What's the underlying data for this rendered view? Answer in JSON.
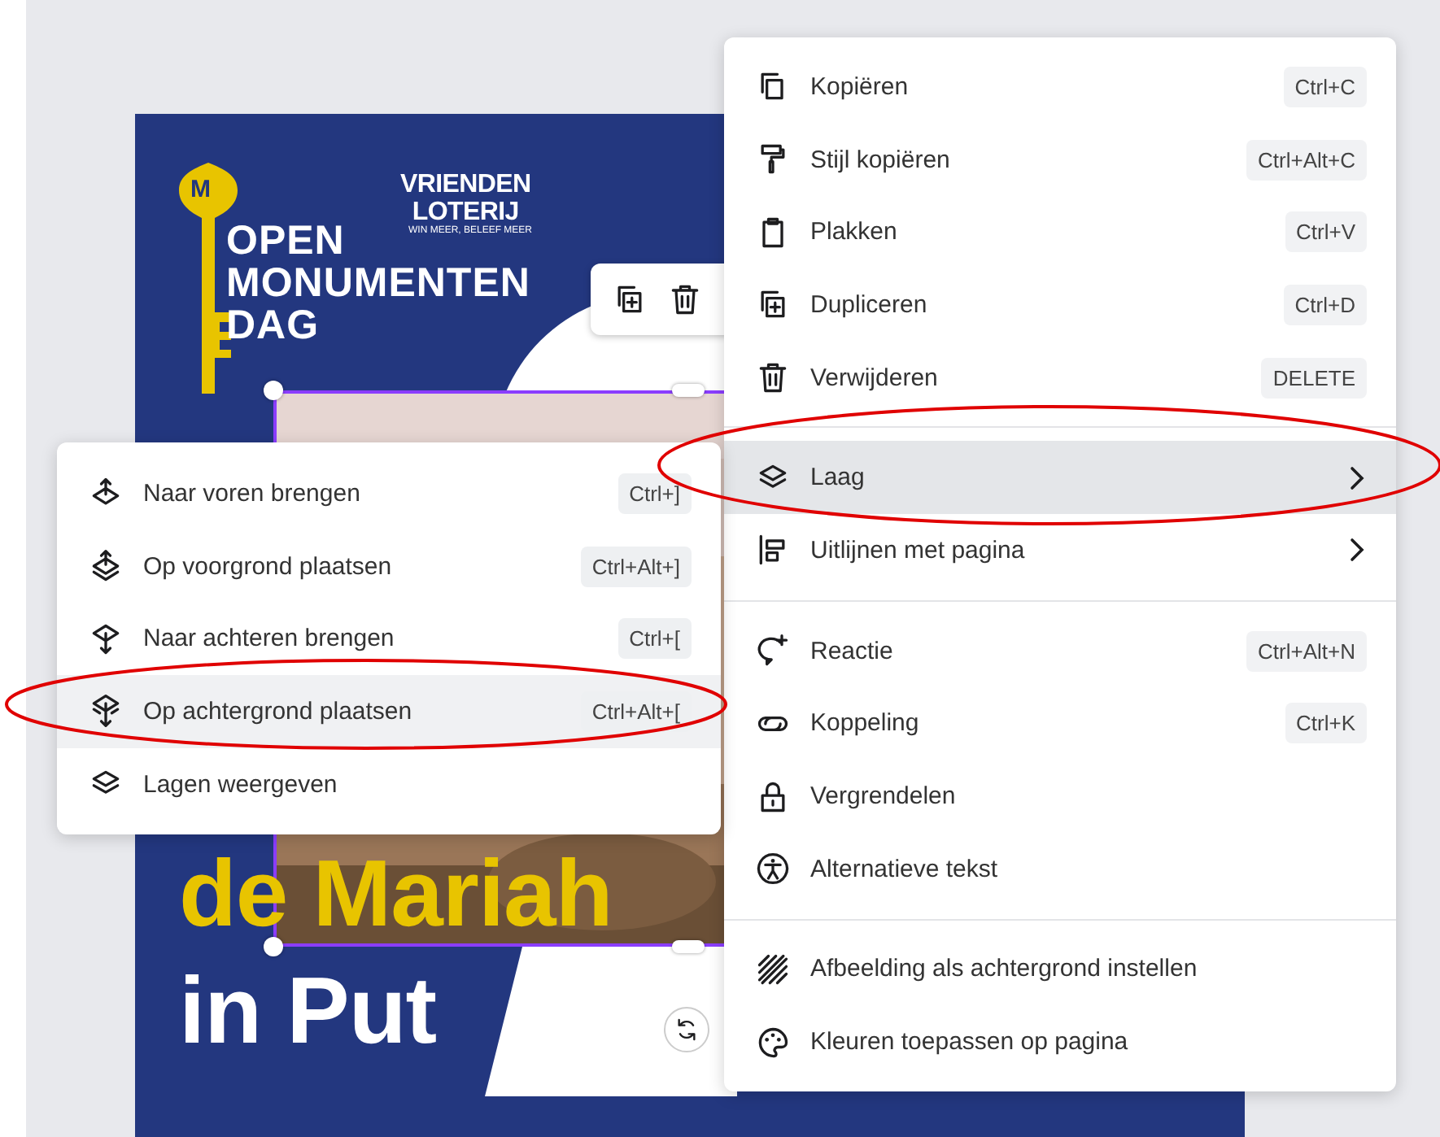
{
  "poster": {
    "key_letter": "M",
    "logo_lines": [
      "VRIENDEN",
      "LOTERIJ"
    ],
    "tagline": "WIN MEER, BELEEF MEER",
    "title_lines": [
      "OPEN",
      "MONUMENTEN",
      "DAG"
    ],
    "headline_lines": [
      "de Mariah",
      "in Put"
    ]
  },
  "context_menu": {
    "sections": [
      {
        "items": [
          {
            "label": "Kopiëren",
            "shortcut": "Ctrl+C",
            "submenu": false,
            "selected": false
          },
          {
            "label": "Stijl kopiëren",
            "shortcut": "Ctrl+Alt+C",
            "submenu": false,
            "selected": false
          },
          {
            "label": "Plakken",
            "shortcut": "Ctrl+V",
            "submenu": false,
            "selected": false
          },
          {
            "label": "Dupliceren",
            "shortcut": "Ctrl+D",
            "submenu": false,
            "selected": false
          },
          {
            "label": "Verwijderen",
            "shortcut": "DELETE",
            "submenu": false,
            "selected": false
          }
        ]
      },
      {
        "items": [
          {
            "label": "Laag",
            "submenu": true,
            "selected": true
          },
          {
            "label": "Uitlijnen met pagina",
            "submenu": true,
            "selected": false
          }
        ]
      },
      {
        "items": [
          {
            "label": "Reactie",
            "shortcut": "Ctrl+Alt+N",
            "submenu": false,
            "selected": false
          },
          {
            "label": "Koppeling",
            "shortcut": "Ctrl+K",
            "submenu": false,
            "selected": false
          },
          {
            "label": "Vergrendelen",
            "submenu": false,
            "selected": false
          },
          {
            "label": "Alternatieve tekst",
            "submenu": false,
            "selected": false
          }
        ]
      },
      {
        "items": [
          {
            "label": "Afbeelding als achtergrond instellen",
            "submenu": false,
            "selected": false
          },
          {
            "label": "Kleuren toepassen op pagina",
            "submenu": false,
            "selected": false
          }
        ]
      }
    ]
  },
  "layer_submenu": {
    "items": [
      {
        "label": "Naar voren brengen",
        "shortcut": "Ctrl+]",
        "selected": false
      },
      {
        "label": "Op voorgrond plaatsen",
        "shortcut": "Ctrl+Alt+]",
        "selected": false
      },
      {
        "label": "Naar achteren brengen",
        "shortcut": "Ctrl+[",
        "selected": false
      },
      {
        "label": "Op achtergrond plaatsen",
        "shortcut": "Ctrl+Alt+[",
        "selected": true
      },
      {
        "label": "Lagen weergeven",
        "selected": false
      }
    ]
  }
}
